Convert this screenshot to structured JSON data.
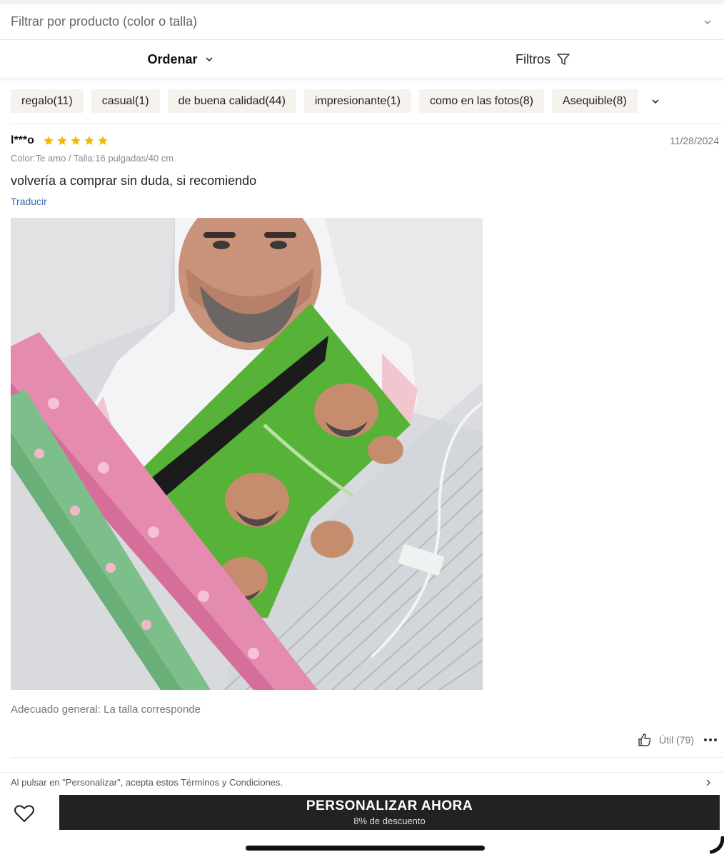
{
  "filter": {
    "placeholder": "Filtrar por producto (color o talla)",
    "icon": "chevron-down-icon"
  },
  "sort": {
    "ordenar_label": "Ordenar",
    "filtros_label": "Filtros"
  },
  "tags": [
    {
      "label": "regalo(11)"
    },
    {
      "label": "casual(1)"
    },
    {
      "label": "de buena calidad(44)"
    },
    {
      "label": "impresionante(1)"
    },
    {
      "label": "como en las fotos(8)"
    },
    {
      "label": "Asequible(8)"
    }
  ],
  "review": {
    "reviewer": "l***o",
    "rating": 5,
    "rating_max": 5,
    "date": "11/28/2024",
    "meta": "Color:Te amo / Talla:16 pulgadas/40 cm",
    "text": "volvería a comprar sin duda, si recomiendo",
    "translate_label": "Traducir",
    "fit": "Adecuado general: La talla corresponde",
    "helpful_label": "Útil (79)"
  },
  "terms": {
    "text": "Al pulsar en \"Personalizar\", acepta estos Términos y Condiciones."
  },
  "cta": {
    "label": "PERSONALIZAR AHORA",
    "sub_label": "8% de descuento"
  },
  "colors": {
    "star": "#f5b800",
    "link": "#3a6ea5",
    "cta_bg": "#222222",
    "tag_bg": "#f6f3ee"
  }
}
